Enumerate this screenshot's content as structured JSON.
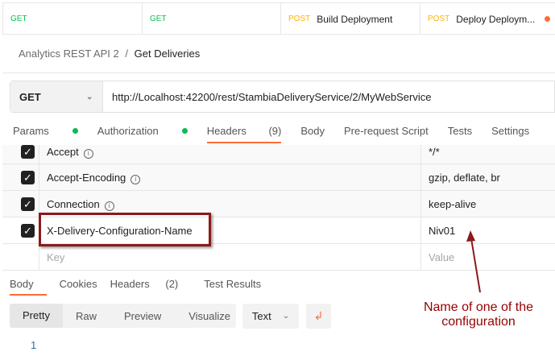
{
  "tabs": [
    {
      "method": "GET",
      "label": ""
    },
    {
      "method": "GET",
      "label": ""
    },
    {
      "method": "POST",
      "label": "Build Deployment"
    },
    {
      "method": "POST",
      "label": "Deploy Deploym...",
      "unsaved": true
    }
  ],
  "breadcrumb": {
    "collection": "Analytics REST API 2",
    "separator": "/",
    "request": "Get Deliveries"
  },
  "request": {
    "method": "GET",
    "url": "http://Localhost:42200/rest/StambiaDeliveryService/2/MyWebService"
  },
  "request_tabs": {
    "params": "Params",
    "authorization": "Authorization",
    "headers": "Headers",
    "headers_count": "(9)",
    "body": "Body",
    "prerequest": "Pre-request Script",
    "tests": "Tests",
    "settings": "Settings"
  },
  "headers": [
    {
      "key": "Accept",
      "value": "*/*",
      "checked": true,
      "info": true
    },
    {
      "key": "Accept-Encoding",
      "value": "gzip, deflate, br",
      "checked": true,
      "info": true
    },
    {
      "key": "Connection",
      "value": "keep-alive",
      "checked": true,
      "info": true
    },
    {
      "key": "X-Delivery-Configuration-Name",
      "value": "Niv01",
      "checked": true
    }
  ],
  "new_header": {
    "key_placeholder": "Key",
    "value_placeholder": "Value"
  },
  "response_tabs": {
    "body": "Body",
    "cookies": "Cookies",
    "headers": "Headers",
    "headers_count": "(2)",
    "test_results": "Test Results"
  },
  "view_modes": [
    "Pretty",
    "Raw",
    "Preview",
    "Visualize"
  ],
  "format": "Text",
  "editor": {
    "line_number": "1"
  },
  "annotation": {
    "line1": "Name of one of the",
    "line2": "configuration",
    "color": "#990000"
  },
  "colors": {
    "accent": "#ff6c37",
    "get": "#0cbb52",
    "post": "#ffb400"
  }
}
